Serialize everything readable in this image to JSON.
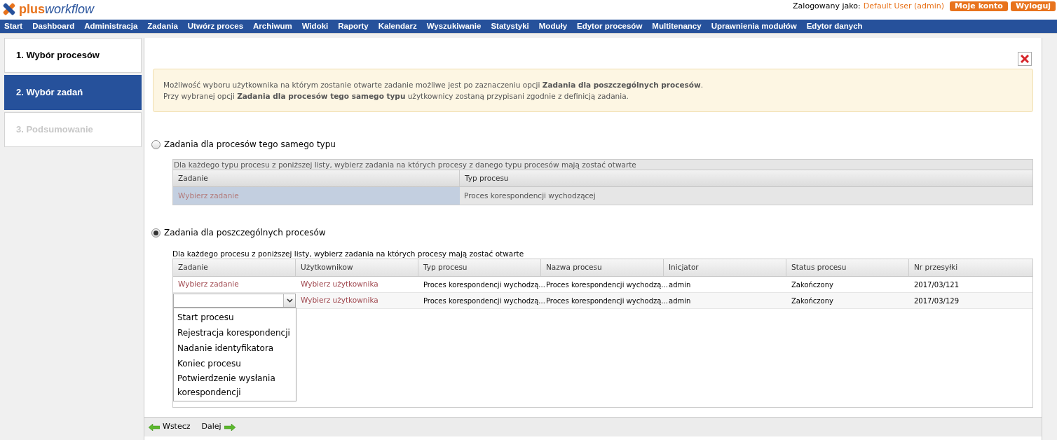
{
  "header": {
    "logo": {
      "plus": "plus",
      "workflow": "workflow"
    },
    "logged_as_label": "Zalogowany jako:",
    "user": "Default User (admin)",
    "buttons": [
      "Moje konto",
      "Wyloguj"
    ]
  },
  "nav": [
    "Start",
    "Dashboard",
    "Administracja",
    "Zadania",
    "Utwórz proces",
    "Archiwum",
    "Widoki",
    "Raporty",
    "Kalendarz",
    "Wyszukiwanie",
    "Statystyki",
    "Moduły",
    "Edytor procesów",
    "Multitenancy",
    "Uprawnienia modułów",
    "Edytor danych"
  ],
  "steps": [
    {
      "label": "1. Wybór procesów",
      "kind": "done",
      "selected": false
    },
    {
      "label": "2. Wybór zadań",
      "kind": "current",
      "selected": true
    },
    {
      "label": "3. Podsumowanie",
      "kind": "disabled",
      "selected": false
    }
  ],
  "notice": [
    "Możliwość wyboru użytkownika na którym zostanie otwarte zadanie możliwe jest po zaznaczeniu opcji **Zadania dla poszczególnych procesów**.",
    "Przy wybranej opcji **Zadania dla procesów tego samego typu** użytkownicy zostaną przypisani zgodnie z definicją zadania."
  ],
  "option_type": {
    "label": "Zadania dla procesów tego samego typu",
    "selected": false,
    "caption": "Dla każdego typu procesu z poniższej listy, wybierz zadania na których procesy z danego typu procesów mają zostać otwarte",
    "columns": [
      "Zadanie",
      "Typ procesu"
    ],
    "rows": [
      {
        "task": "Wybierz zadanie",
        "type": "Proces korespondencji wychodzącej",
        "selected": true
      }
    ]
  },
  "option_each": {
    "label": "Zadania dla poszczególnych procesów",
    "selected": true,
    "caption": "Dla każdego procesu z poniższej listy, wybierz zadania na których procesy mają zostać otwarte",
    "columns": [
      "Zadanie",
      "Użytkownikow",
      "Typ procesu",
      "Nazwa procesu",
      "Inicjator",
      "Status procesu",
      "Nr przesyłki"
    ],
    "rows": [
      {
        "kind": "link",
        "task": "Wybierz zadanie",
        "user": "Wybierz użytkownika",
        "type": "Proces korespondencji wychodzą...",
        "name": "Proces korespondencji wychodzą...",
        "initiator": "admin",
        "status": "Zakończony",
        "number": "2017/03/121"
      },
      {
        "kind": "select",
        "task": "",
        "user": "Wybierz użytkownika",
        "type": "Proces korespondencji wychodzą...",
        "name": "Proces korespondencji wychodzą...",
        "initiator": "admin",
        "status": "Zakończony",
        "number": "2017/03/129"
      }
    ],
    "dropdown_options": [
      "Start procesu",
      "Rejestracja korespondencji",
      "Nadanie identyfikatora",
      "Koniec procesu",
      "Potwierdzenie wysłania korespondencji"
    ]
  },
  "footer": {
    "back": "Wstecz",
    "next": "Dalej"
  }
}
